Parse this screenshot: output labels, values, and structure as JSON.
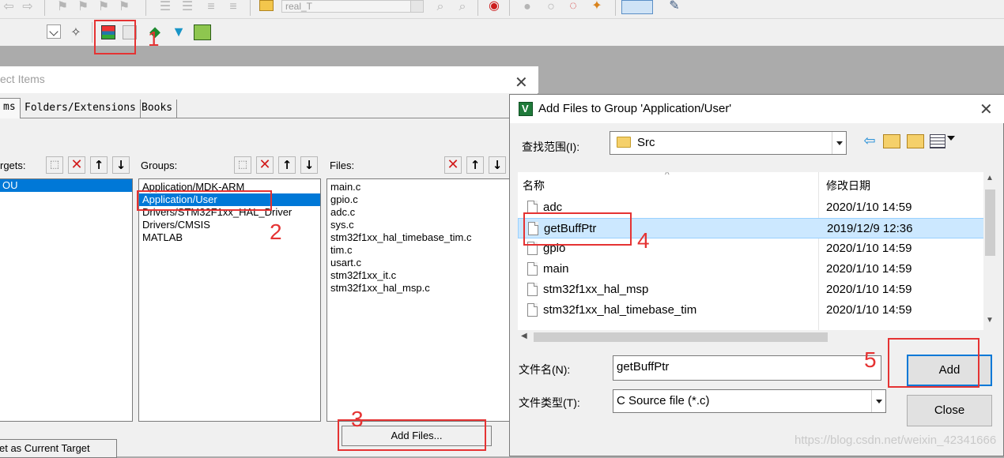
{
  "toolbar": {
    "target_combo": "real_T",
    "manage_label": "1"
  },
  "manage_dialog": {
    "title": "ect Items",
    "tabs": [
      "ms",
      "Folders/Extensions",
      "Books"
    ],
    "targets_label": "rgets:",
    "targets": [
      "OU"
    ],
    "groups_label": "Groups:",
    "groups": [
      "Application/MDK-ARM",
      "Application/User",
      "Drivers/STM32F1xx_HAL_Driver",
      "Drivers/CMSIS",
      "MATLAB"
    ],
    "selected_group": 1,
    "files_label": "Files:",
    "files": [
      "main.c",
      "gpio.c",
      "adc.c",
      "sys.c",
      "stm32f1xx_hal_timebase_tim.c",
      "tim.c",
      "usart.c",
      "stm32f1xx_it.c",
      "stm32f1xx_hal_msp.c"
    ],
    "add_files_label": "Add Files...",
    "set_target_label": "et as Current Target"
  },
  "add_dialog": {
    "title": "Add Files to Group 'Application/User'",
    "look_in_label": "查找范围(I):",
    "look_in_value": "Src",
    "col_name": "名称",
    "col_date": "修改日期",
    "files": [
      {
        "name": "adc",
        "date": "2020/1/10 14:59"
      },
      {
        "name": "getBuffPtr",
        "date": "2019/12/9 12:36",
        "selected": true
      },
      {
        "name": "gpio",
        "date": "2020/1/10 14:59"
      },
      {
        "name": "main",
        "date": "2020/1/10 14:59"
      },
      {
        "name": "stm32f1xx_hal_msp",
        "date": "2020/1/10 14:59"
      },
      {
        "name": "stm32f1xx_hal_timebase_tim",
        "date": "2020/1/10 14:59"
      }
    ],
    "filename_label": "文件名(N):",
    "filename_value": "getBuffPtr",
    "filetype_label": "文件类型(T):",
    "filetype_value": "C Source file (*.c)",
    "add_label": "Add",
    "close_label": "Close"
  },
  "annotations": {
    "n1": "1",
    "n2": "2",
    "n3": "3",
    "n4": "4",
    "n5": "5"
  },
  "watermark": "https://blog.csdn.net/weixin_42341666",
  "colors": {
    "selection": "#0078d7",
    "annotation": "#e53333",
    "list_selection": "#cce8ff"
  }
}
